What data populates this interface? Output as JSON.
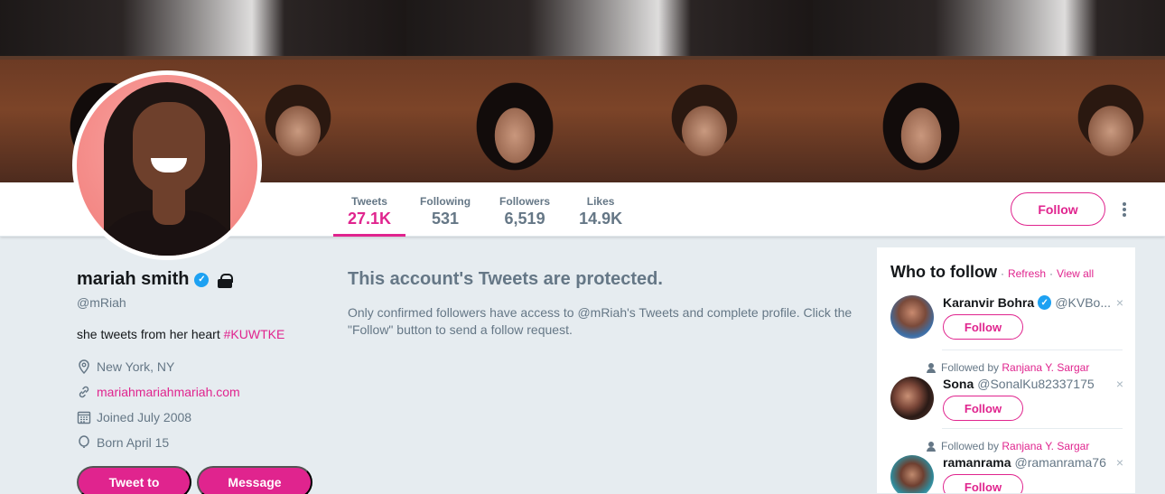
{
  "banner": {
    "description_icon": "banner-photo"
  },
  "stats": [
    {
      "label": "Tweets",
      "value": "27.1K"
    },
    {
      "label": "Following",
      "value": "531"
    },
    {
      "label": "Followers",
      "value": "6,519"
    },
    {
      "label": "Likes",
      "value": "14.9K"
    }
  ],
  "header": {
    "follow_label": "Follow"
  },
  "profile": {
    "name": "mariah smith",
    "handle": "@mRiah",
    "bio_text": "she tweets from her heart ",
    "bio_tag": "#KUWTKE",
    "location": "New York, NY",
    "website": "mariahmariahmariah.com",
    "joined": "Joined July 2008",
    "born": "Born April 15",
    "tweet_to_label": "Tweet to",
    "message_label": "Message"
  },
  "protected": {
    "title": "This account's Tweets are protected.",
    "message": "Only confirmed followers have access to @mRiah's Tweets and complete profile. Click the \"Follow\" button to send a follow request."
  },
  "who_to_follow": {
    "title": "Who to follow",
    "dot": "·",
    "refresh": "Refresh",
    "view_all": "View all",
    "suggestions": [
      {
        "context": "",
        "context_name": "",
        "name": "Karanvir Bohra",
        "handle": "@KVBo...",
        "verified": true,
        "follow_label": "Follow"
      },
      {
        "context": "Followed by ",
        "context_name": "Ranjana Y. Sargar",
        "name": "Sona",
        "handle": "@SonalKu82337175",
        "verified": false,
        "follow_label": "Follow"
      },
      {
        "context": "Followed by ",
        "context_name": "Ranjana Y. Sargar",
        "name": "ramanrama",
        "handle": "@ramanrama76",
        "verified": false,
        "follow_label": "Follow"
      }
    ],
    "close_glyph": "×"
  },
  "colors": {
    "accent": "#e0248e",
    "verified": "#1da1f2",
    "muted": "#657786",
    "background": "#e6ecf0"
  }
}
